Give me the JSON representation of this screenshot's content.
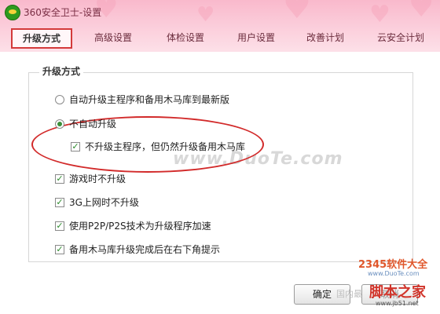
{
  "window": {
    "title": "360安全卫士-设置"
  },
  "tabs": [
    {
      "label": "升级方式",
      "active": true
    },
    {
      "label": "高级设置",
      "active": false
    },
    {
      "label": "体检设置",
      "active": false
    },
    {
      "label": "用户设置",
      "active": false
    },
    {
      "label": "改善计划",
      "active": false
    },
    {
      "label": "云安全计划",
      "active": false
    }
  ],
  "group": {
    "title": "升级方式"
  },
  "options": {
    "radio_auto": {
      "label": "自动升级主程序和备用木马库到最新版",
      "selected": false
    },
    "radio_no_auto": {
      "label": "不自动升级",
      "selected": true
    },
    "check_no_main": {
      "label": "不升级主程序，但仍然升级备用木马库",
      "checked": true
    },
    "check_game": {
      "label": "游戏时不升级",
      "checked": true
    },
    "check_3g": {
      "label": "3G上网时不升级",
      "checked": true
    },
    "check_p2p": {
      "label": "使用P2P/P2S技术为升级程序加速",
      "checked": true
    },
    "check_notify": {
      "label": "备用木马库升级完成后在右下角提示",
      "checked": true
    }
  },
  "buttons": {
    "ok": "确定",
    "cancel_partial": "取消"
  },
  "overlay": {
    "watermark": "www.DuoTe.com",
    "brand_a": "2345软件大全",
    "brand_a_url": "www.DuoTe.com",
    "brand_b": "脚本之家",
    "brand_b_url": "www.jb51.net",
    "guonei": "国内最"
  },
  "colors": {
    "titlebar_pink": "#f9b9cc",
    "highlight_red": "#d22a2a",
    "check_green": "#2a8a2a"
  }
}
